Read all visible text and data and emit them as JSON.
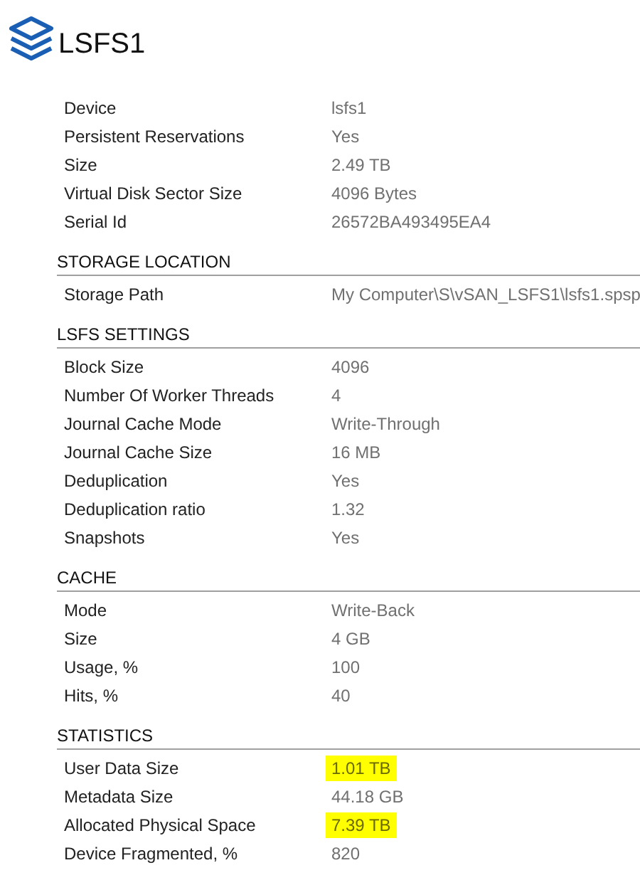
{
  "title": "LSFS1",
  "sections": [
    {
      "rows": [
        {
          "label": "Device",
          "value": "lsfs1",
          "highlighted": false
        },
        {
          "label": "Persistent Reservations",
          "value": "Yes",
          "highlighted": false
        },
        {
          "label": "Size",
          "value": "2.49 TB",
          "highlighted": false
        },
        {
          "label": "Virtual Disk Sector Size",
          "value": "4096 Bytes",
          "highlighted": false
        },
        {
          "label": "Serial Id",
          "value": "26572BA493495EA4",
          "highlighted": false
        }
      ]
    },
    {
      "heading": "STORAGE LOCATION",
      "rows": [
        {
          "label": "Storage Path",
          "value": "My Computer\\S\\vSAN_LSFS1\\lsfs1.spsp",
          "highlighted": false
        }
      ]
    },
    {
      "heading": "LSFS SETTINGS",
      "rows": [
        {
          "label": "Block Size",
          "value": "4096",
          "highlighted": false
        },
        {
          "label": "Number Of Worker Threads",
          "value": "4",
          "highlighted": false
        },
        {
          "label": "Journal Cache Mode",
          "value": "Write-Through",
          "highlighted": false
        },
        {
          "label": "Journal Cache Size",
          "value": "16 MB",
          "highlighted": false
        },
        {
          "label": "Deduplication",
          "value": "Yes",
          "highlighted": false
        },
        {
          "label": "Deduplication ratio",
          "value": "1.32",
          "highlighted": false
        },
        {
          "label": "Snapshots",
          "value": "Yes",
          "highlighted": false
        }
      ]
    },
    {
      "heading": "CACHE",
      "rows": [
        {
          "label": "Mode",
          "value": "Write-Back",
          "highlighted": false
        },
        {
          "label": "Size",
          "value": "4 GB",
          "highlighted": false
        },
        {
          "label": "Usage, %",
          "value": "100",
          "highlighted": false
        },
        {
          "label": "Hits, %",
          "value": "40",
          "highlighted": false
        }
      ]
    },
    {
      "heading": "STATISTICS",
      "rows": [
        {
          "label": "User Data Size",
          "value": "1.01 TB",
          "highlighted": true
        },
        {
          "label": "Metadata Size",
          "value": "44.18 GB",
          "highlighted": false
        },
        {
          "label": "Allocated Physical Space",
          "value": "7.39 TB",
          "highlighted": true
        },
        {
          "label": "Device Fragmented, %",
          "value": "820",
          "highlighted": false
        }
      ]
    }
  ]
}
